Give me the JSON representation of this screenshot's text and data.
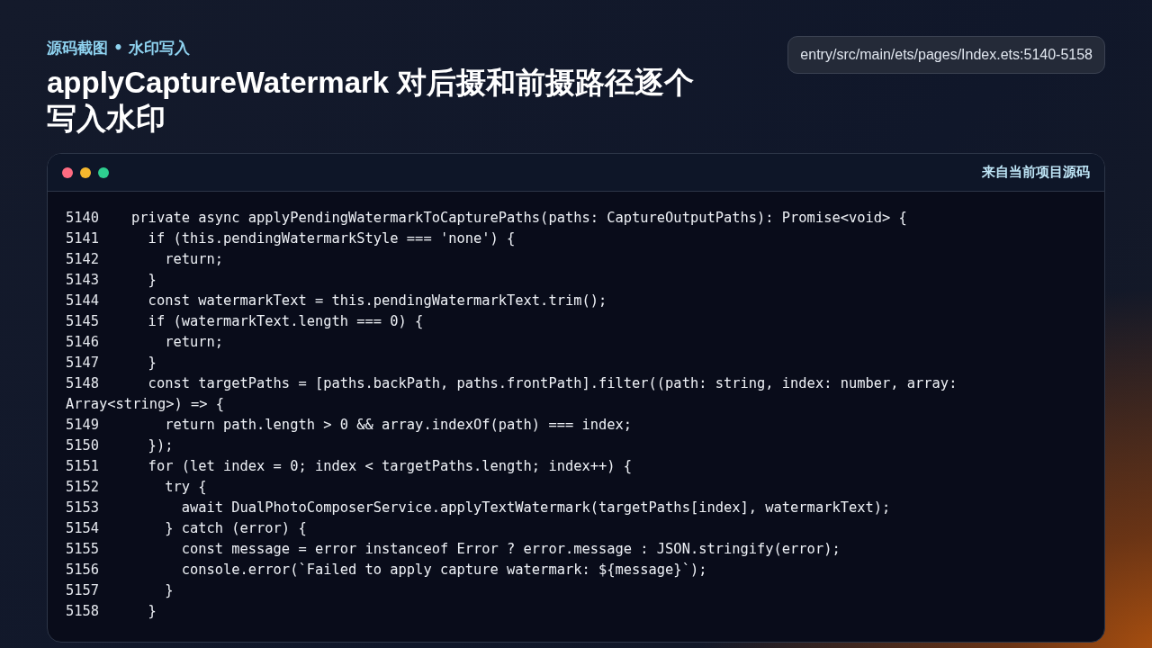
{
  "header": {
    "eyebrow": "源码截图 • 水印写入",
    "title": "applyCaptureWatermark 对后摄和前摄路径逐个写入水印",
    "file_path": "entry/src/main/ets/pages/Index.ets:5140-5158"
  },
  "code_window": {
    "dots": [
      {
        "color": "#ff6b81"
      },
      {
        "color": "#f5b82e"
      },
      {
        "color": "#2ecf8f"
      }
    ],
    "source_label": "来自当前项目源码",
    "lines": [
      {
        "number": "5140",
        "code": "private async applyPendingWatermarkToCapturePaths(paths: CaptureOutputPaths): Promise<void> {"
      },
      {
        "number": "5141",
        "code": "  if (this.pendingWatermarkStyle === 'none') {"
      },
      {
        "number": "5142",
        "code": "    return;"
      },
      {
        "number": "5143",
        "code": "  }"
      },
      {
        "number": "5144",
        "code": "  const watermarkText = this.pendingWatermarkText.trim();"
      },
      {
        "number": "5145",
        "code": "  if (watermarkText.length === 0) {"
      },
      {
        "number": "5146",
        "code": "    return;"
      },
      {
        "number": "5147",
        "code": "  }"
      },
      {
        "number": "5148",
        "code": "  const targetPaths = [paths.backPath, paths.frontPath].filter((path: string, index: number, array:",
        "continuation": "Array<string>) => {"
      },
      {
        "number": "5149",
        "code": "    return path.length > 0 && array.indexOf(path) === index;"
      },
      {
        "number": "5150",
        "code": "  });"
      },
      {
        "number": "5151",
        "code": "  for (let index = 0; index < targetPaths.length; index++) {"
      },
      {
        "number": "5152",
        "code": "    try {"
      },
      {
        "number": "5153",
        "code": "      await DualPhotoComposerService.applyTextWatermark(targetPaths[index], watermarkText);"
      },
      {
        "number": "5154",
        "code": "    } catch (error) {"
      },
      {
        "number": "5155",
        "code": "      const message = error instanceof Error ? error.message : JSON.stringify(error);"
      },
      {
        "number": "5156",
        "code": "      console.error(`Failed to apply capture watermark: ${message}`);"
      },
      {
        "number": "5157",
        "code": "    }"
      },
      {
        "number": "5158",
        "code": "  }"
      }
    ]
  }
}
